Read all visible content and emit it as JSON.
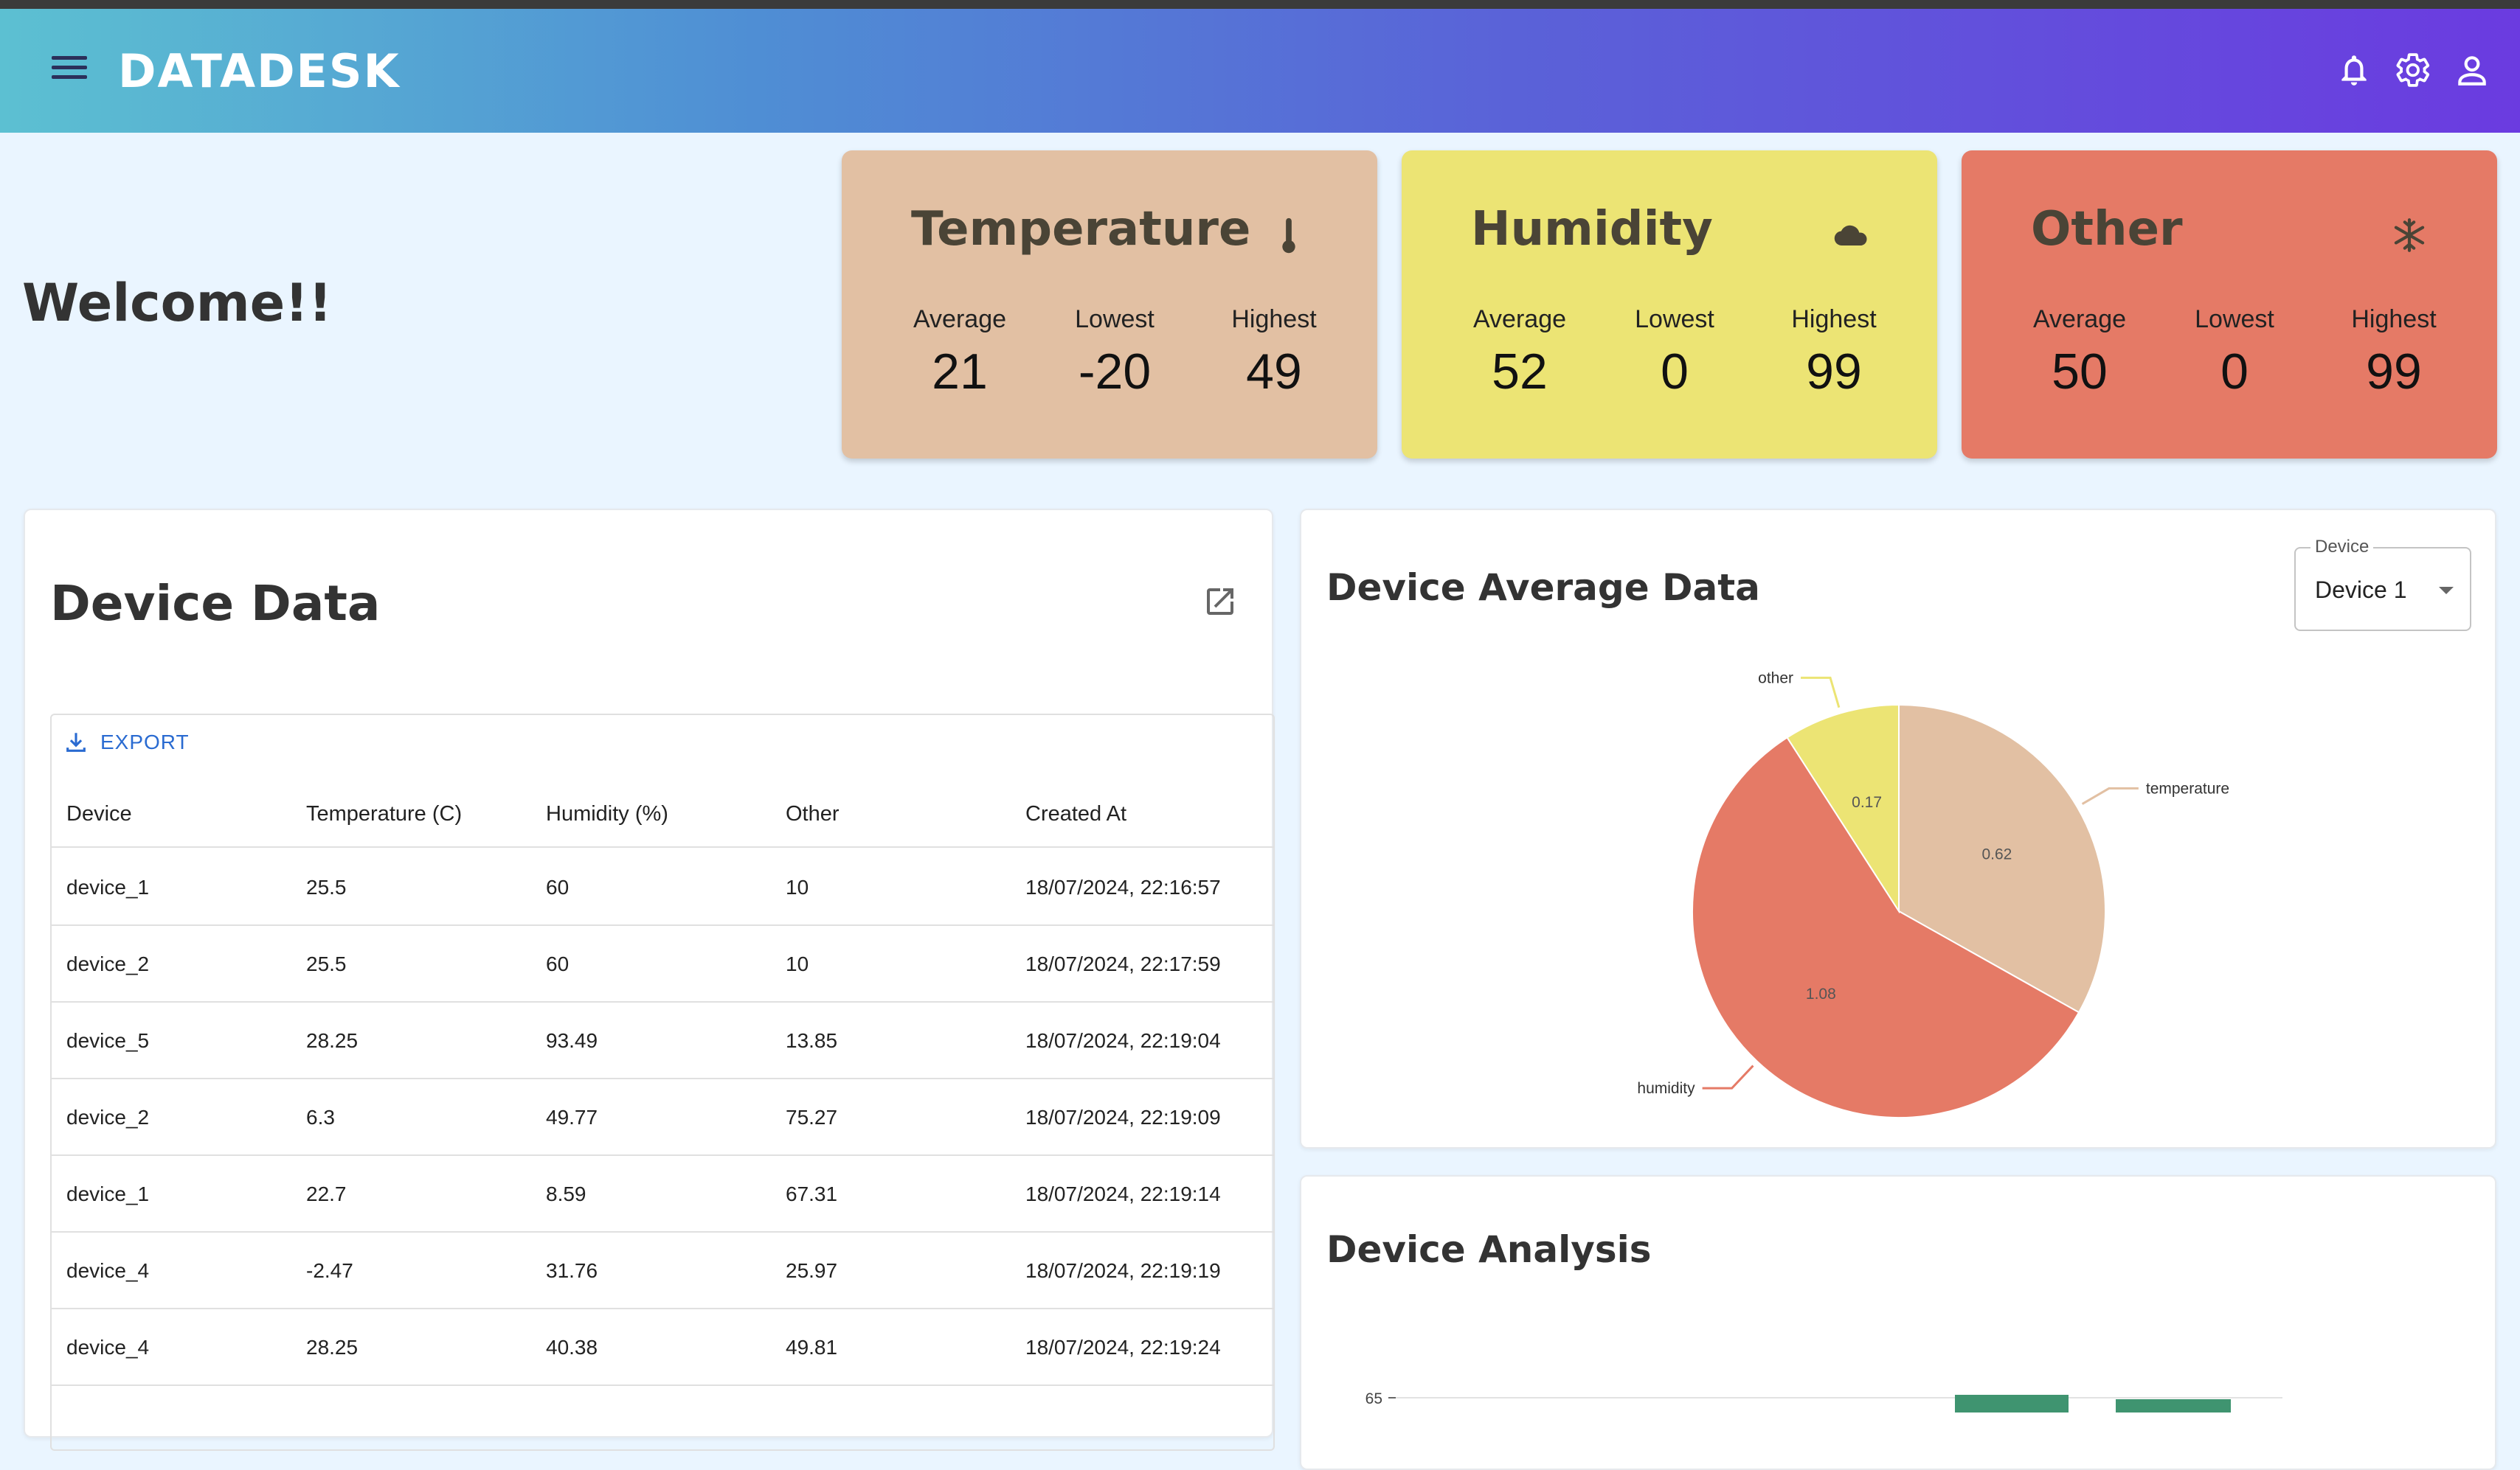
{
  "app": {
    "brand": "DATADESK",
    "icons": [
      "menu-icon",
      "bell-icon",
      "gear-icon",
      "user-icon"
    ]
  },
  "welcome": "Welcome!!",
  "cards": [
    {
      "title": "Temperature",
      "icon": "thermometer-icon",
      "color": "#e2c0a3",
      "average_label": "Average",
      "lowest_label": "Lowest",
      "highest_label": "Highest",
      "average": "21",
      "lowest": "-20",
      "highest": "49"
    },
    {
      "title": "Humidity",
      "icon": "cloud-icon",
      "color": "#ece474",
      "average_label": "Average",
      "lowest_label": "Lowest",
      "highest_label": "Highest",
      "average": "52",
      "lowest": "0",
      "highest": "99"
    },
    {
      "title": "Other",
      "icon": "snowflake-icon",
      "color": "#e57a66",
      "average_label": "Average",
      "lowest_label": "Lowest",
      "highest_label": "Highest",
      "average": "50",
      "lowest": "0",
      "highest": "99"
    }
  ],
  "device_data": {
    "title": "Device Data",
    "export_label": "EXPORT",
    "columns": [
      "Device",
      "Temperature (C)",
      "Humidity (%)",
      "Other",
      "Created At"
    ],
    "rows": [
      [
        "device_1",
        "25.5",
        "60",
        "10",
        "18/07/2024, 22:16:57"
      ],
      [
        "device_2",
        "25.5",
        "60",
        "10",
        "18/07/2024, 22:17:59"
      ],
      [
        "device_5",
        "28.25",
        "93.49",
        "13.85",
        "18/07/2024, 22:19:04"
      ],
      [
        "device_2",
        "6.3",
        "49.77",
        "75.27",
        "18/07/2024, 22:19:09"
      ],
      [
        "device_1",
        "22.7",
        "8.59",
        "67.31",
        "18/07/2024, 22:19:14"
      ],
      [
        "device_4",
        "-2.47",
        "31.76",
        "25.97",
        "18/07/2024, 22:19:19"
      ],
      [
        "device_4",
        "28.25",
        "40.38",
        "49.81",
        "18/07/2024, 22:19:24"
      ]
    ]
  },
  "device_average": {
    "title": "Device Average Data",
    "select_label": "Device",
    "select_value": "Device 1"
  },
  "device_analysis": {
    "title": "Device Analysis"
  },
  "chart_data": [
    {
      "type": "pie",
      "title": "Device Average Data",
      "slices": [
        {
          "label": "temperature",
          "value": 0.62,
          "color": "#e2c0a3"
        },
        {
          "label": "humidity",
          "value": 1.08,
          "color": "#e57a66"
        },
        {
          "label": "other",
          "value": 0.17,
          "color": "#ece474"
        }
      ]
    },
    {
      "type": "bar",
      "title": "Device Analysis",
      "y_ticks": [
        "65"
      ],
      "series_color": "#3f9470",
      "visible_bar_tops": [
        65,
        64
      ]
    }
  ]
}
